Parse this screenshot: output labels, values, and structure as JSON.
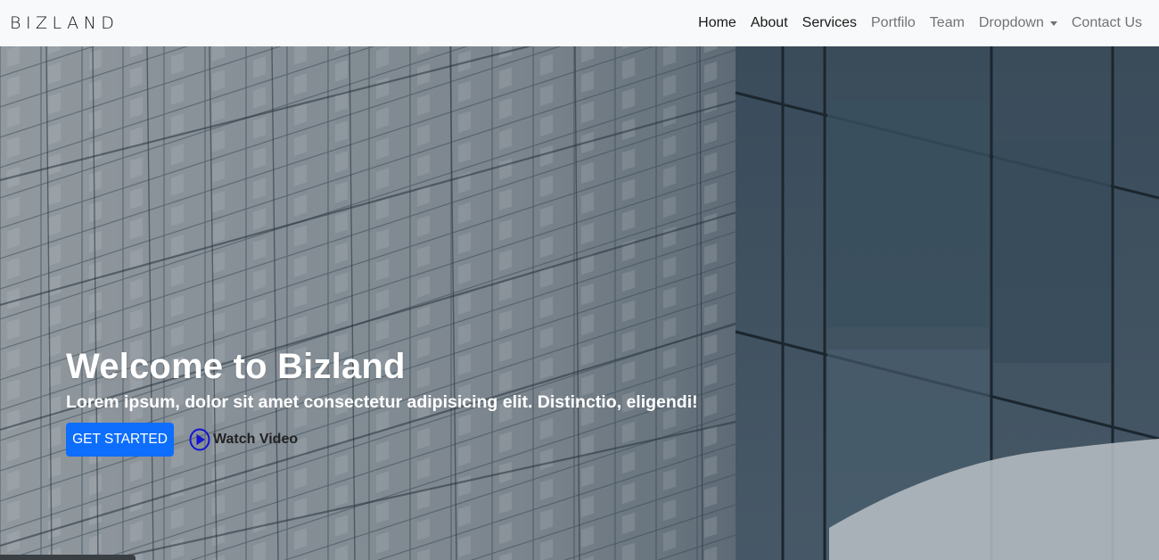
{
  "navbar": {
    "brand": "BIZLAND",
    "links": [
      {
        "label": "Home"
      },
      {
        "label": "About"
      },
      {
        "label": "Services"
      },
      {
        "label": "Portfilo"
      },
      {
        "label": "Team"
      },
      {
        "label": "Dropdown"
      },
      {
        "label": "Contact Us"
      }
    ]
  },
  "hero": {
    "background": "glass-building-photo",
    "title": "Welcome to Bizland",
    "subtitle": "Lorem ipsum, dolor sit amet consectetur adipisicing elit. Distinctio, eligendi!",
    "primary_button": "GET STARTED",
    "video_link": "Watch Video",
    "video_icon": "play-circle-icon"
  },
  "colors": {
    "primary": "#0d6efd",
    "navbar_bg": "#f8f9fa",
    "play_icon": "#1414d2"
  }
}
